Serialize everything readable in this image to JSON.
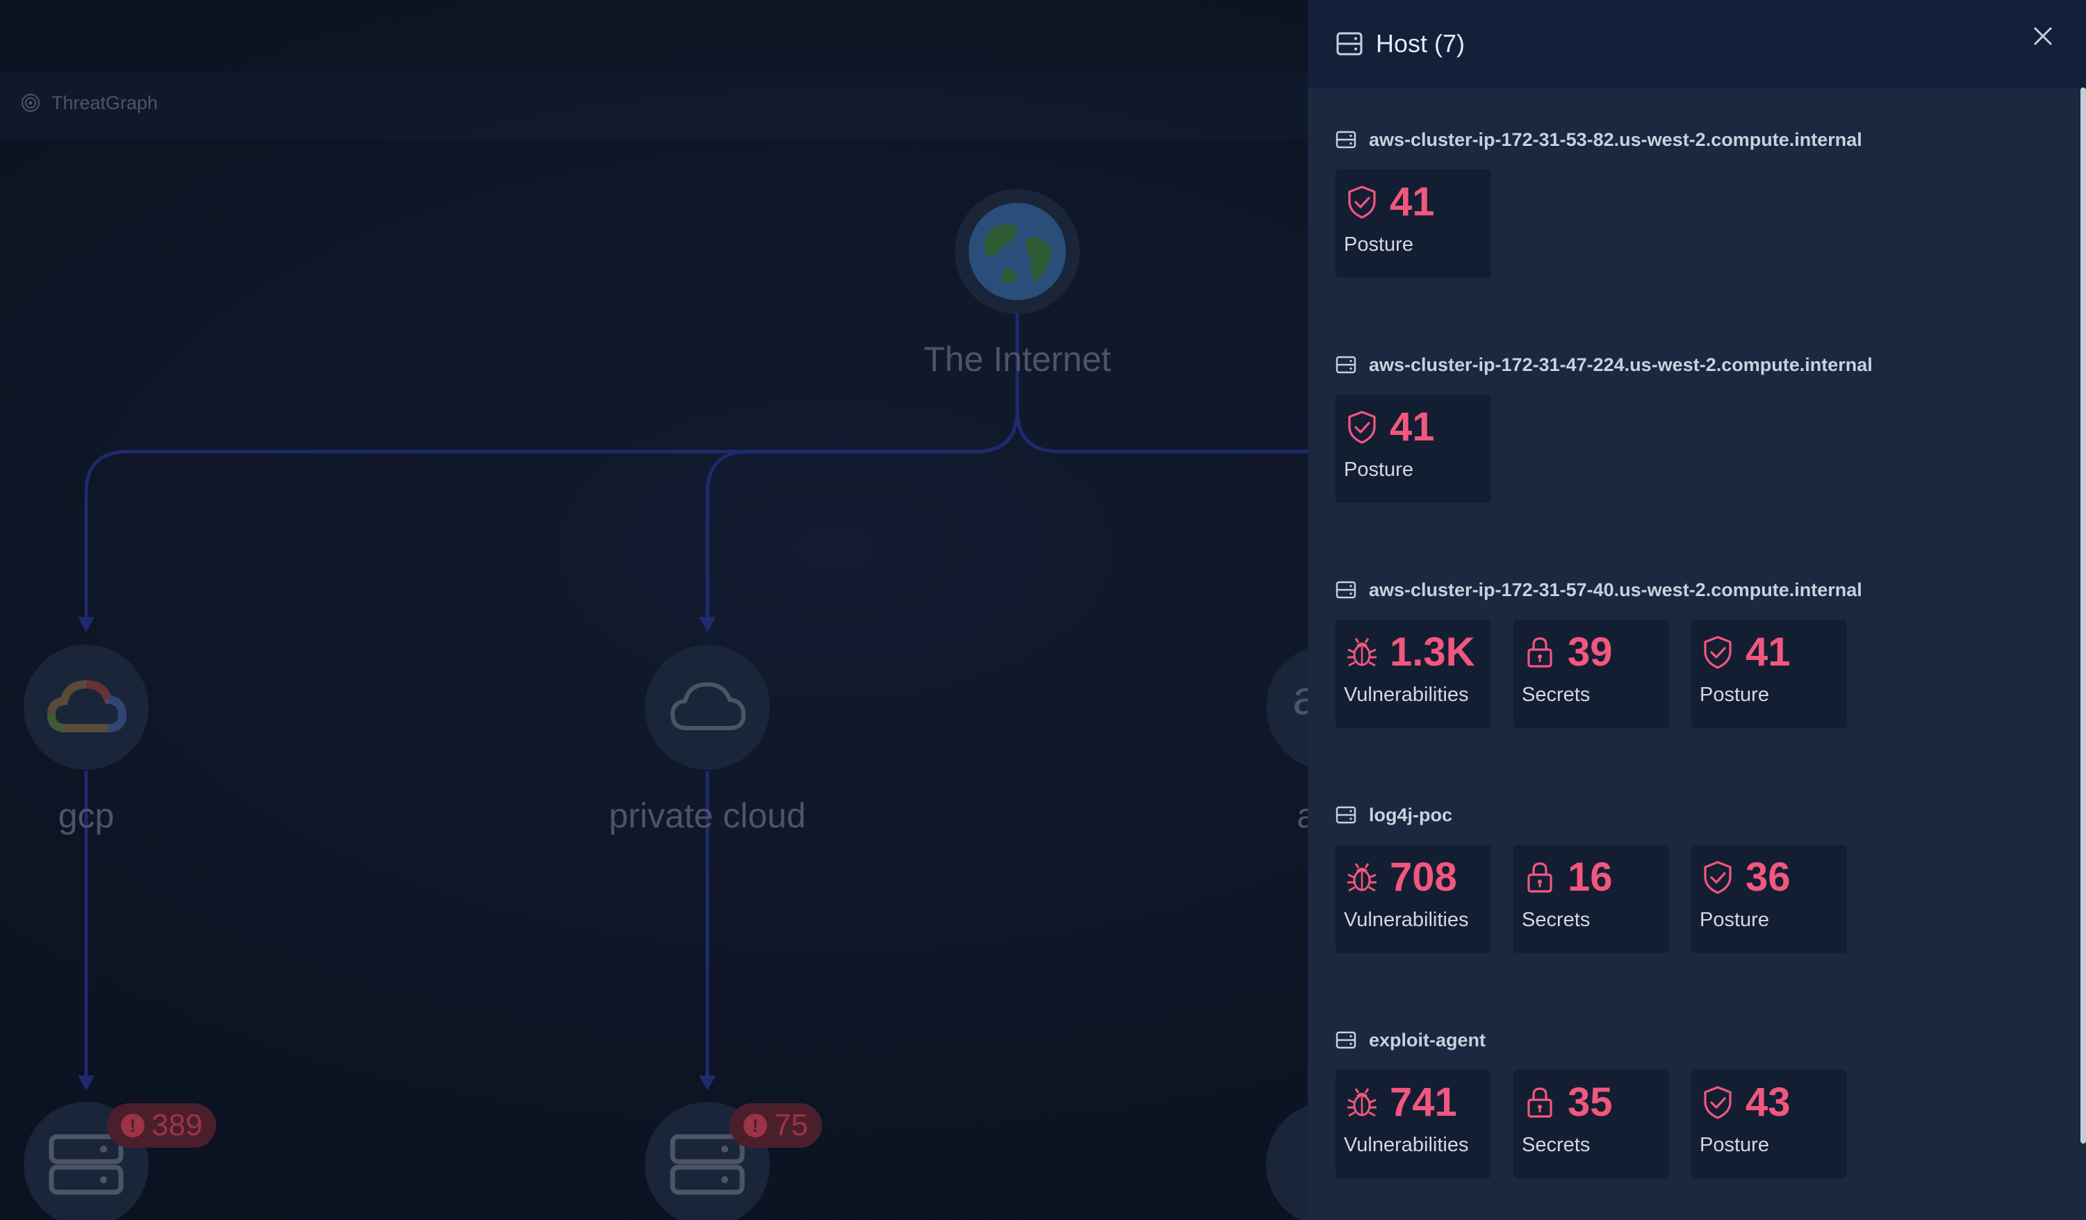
{
  "graph": {
    "brand": "ThreatGraph",
    "root_label": "The Internet",
    "clouds": [
      {
        "label": "gcp",
        "badge": "389"
      },
      {
        "label": "private cloud",
        "badge": "75"
      },
      {
        "label": "a",
        "badge": ""
      }
    ]
  },
  "panel": {
    "title": "Host (7)",
    "hosts": [
      {
        "name": "aws-cluster-ip-172-31-53-82.us-west-2.compute.internal",
        "stats": [
          {
            "kind": "posture",
            "value": "41",
            "label": "Posture"
          }
        ]
      },
      {
        "name": "aws-cluster-ip-172-31-47-224.us-west-2.compute.internal",
        "stats": [
          {
            "kind": "posture",
            "value": "41",
            "label": "Posture"
          }
        ]
      },
      {
        "name": "aws-cluster-ip-172-31-57-40.us-west-2.compute.internal",
        "stats": [
          {
            "kind": "vulnerabilities",
            "value": "1.3K",
            "label": "Vulnerabilities"
          },
          {
            "kind": "secrets",
            "value": "39",
            "label": "Secrets"
          },
          {
            "kind": "posture",
            "value": "41",
            "label": "Posture"
          }
        ]
      },
      {
        "name": "log4j-poc",
        "stats": [
          {
            "kind": "vulnerabilities",
            "value": "708",
            "label": "Vulnerabilities"
          },
          {
            "kind": "secrets",
            "value": "16",
            "label": "Secrets"
          },
          {
            "kind": "posture",
            "value": "36",
            "label": "Posture"
          }
        ]
      },
      {
        "name": "exploit-agent",
        "stats": [
          {
            "kind": "vulnerabilities",
            "value": "741",
            "label": "Vulnerabilities"
          },
          {
            "kind": "secrets",
            "value": "35",
            "label": "Secrets"
          },
          {
            "kind": "posture",
            "value": "43",
            "label": "Posture"
          }
        ]
      }
    ]
  },
  "colors": {
    "accent": "#f2577d",
    "panel_bg": "#1a2840",
    "card_bg": "#131e33",
    "edge": "#1e2a6e"
  }
}
